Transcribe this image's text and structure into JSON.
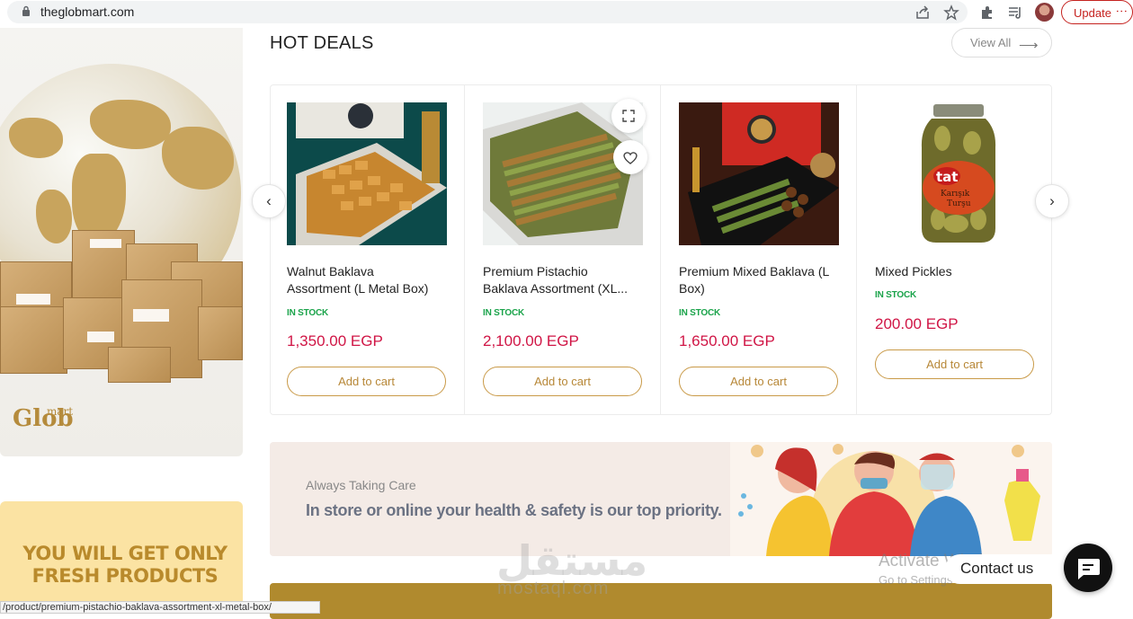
{
  "browser": {
    "url": "theglobmart.com",
    "update_label": "Update"
  },
  "banner_left": {
    "logo_small": "mart",
    "logo_big": "Glob"
  },
  "fresh_banner": {
    "line1": "YOU WILL GET ONLY",
    "line2": "FRESH PRODUCTS"
  },
  "hot_deals": {
    "title": "HOT DEALS",
    "view_all": "View All",
    "products": [
      {
        "name_l1": "Walnut Baklava",
        "name_l2": "Assortment (L Metal Box)",
        "stock": "IN STOCK",
        "price": "1,350.00 EGP",
        "cart": "Add to cart"
      },
      {
        "name_l1": "Premium Pistachio",
        "name_l2": "Baklava Assortment (XL...",
        "stock": "IN STOCK",
        "price": "2,100.00 EGP",
        "cart": "Add to cart"
      },
      {
        "name_l1": "Premium Mixed Baklava (L",
        "name_l2": "Box)",
        "stock": "IN STOCK",
        "price": "1,650.00 EGP",
        "cart": "Add to cart"
      },
      {
        "name_l1": "Mixed Pickles",
        "name_l2": "",
        "stock": "IN STOCK",
        "price": "200.00 EGP",
        "cart": "Add to cart"
      }
    ]
  },
  "care_banner": {
    "small": "Always Taking Care",
    "main": "In store or online your health & safety is our top priority."
  },
  "overlays": {
    "watermark_ar": "مستقل",
    "watermark_lat": "mostaql.com",
    "activate_title": "Activate Windows",
    "activate_sub": "Go to Settings to activate Windows.",
    "contact_us": "Contact us",
    "status_url": "/product/premium-pistachio-baklava-assortment-xl-metal-box/"
  },
  "colors": {
    "price": "#d01545",
    "stock": "#1aa34a",
    "accent_gold": "#b78737",
    "update_red": "#c5221f"
  }
}
